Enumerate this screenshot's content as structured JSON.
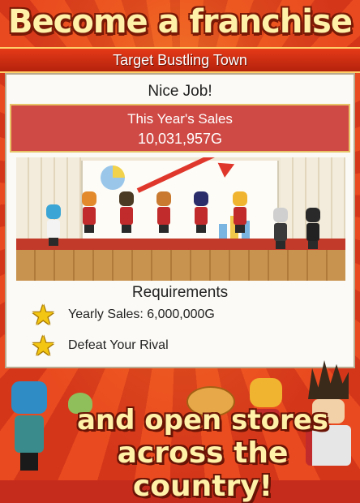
{
  "header": {
    "headline": "Become a franchise",
    "subtitle": "Target Bustling Town"
  },
  "panel": {
    "title": "Nice Job!",
    "sales": {
      "label": "This Year's Sales",
      "value": "10,031,957G"
    },
    "requirements": {
      "title": "Requirements",
      "items": [
        {
          "text": "Yearly Sales: 6,000,000G",
          "icon": "star-icon"
        },
        {
          "text": "Defeat Your Rival",
          "icon": "star-icon"
        }
      ]
    }
  },
  "footer": {
    "line1": "and open stores",
    "line2": "across the country!"
  },
  "colors": {
    "sales_box": "#cf4a45",
    "star": "#f3c614",
    "headline": "#fff2a8",
    "background_red": "#c62c1c"
  }
}
